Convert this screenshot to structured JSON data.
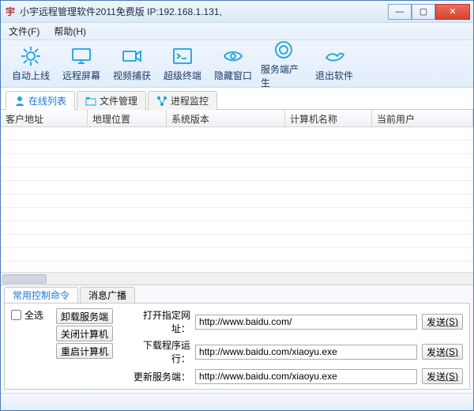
{
  "title": "小宇远程管理软件2011免费版 IP:192.168.1.131,",
  "menubar": {
    "file": "文件(F)",
    "help": "帮助(H)"
  },
  "toolbar": {
    "auto_online": "自动上线",
    "remote_screen": "远程屏幕",
    "video_capture": "视频捕获",
    "super_terminal": "超级终端",
    "hide_window": "隐藏窗口",
    "server_gen": "服务端产生",
    "exit": "退出软件"
  },
  "tabs": {
    "online": "在线列表",
    "files": "文件管理",
    "process": "进程监控"
  },
  "columns": {
    "client_addr": "客户地址",
    "geo": "地理位置",
    "sys_ver": "系统版本",
    "pc_name": "计算机名称",
    "cur_user": "当前用户"
  },
  "bottom_tabs": {
    "commands": "常用控制命令",
    "broadcast": "消息广播"
  },
  "control": {
    "select_all": "全选",
    "uninstall": "卸载服务端",
    "shutdown": "关闭计算机",
    "restart": "重启计算机",
    "open_url_label": "打开指定网址：",
    "open_url_value": "http://www.baidu.com/",
    "download_label": "下载程序运行：",
    "download_value": "http://www.baidu.com/xiaoyu.exe",
    "update_label": "更新服务端：",
    "update_value": "http://www.baidu.com/xiaoyu.exe",
    "send": "发送",
    "send_key": "(S)"
  }
}
